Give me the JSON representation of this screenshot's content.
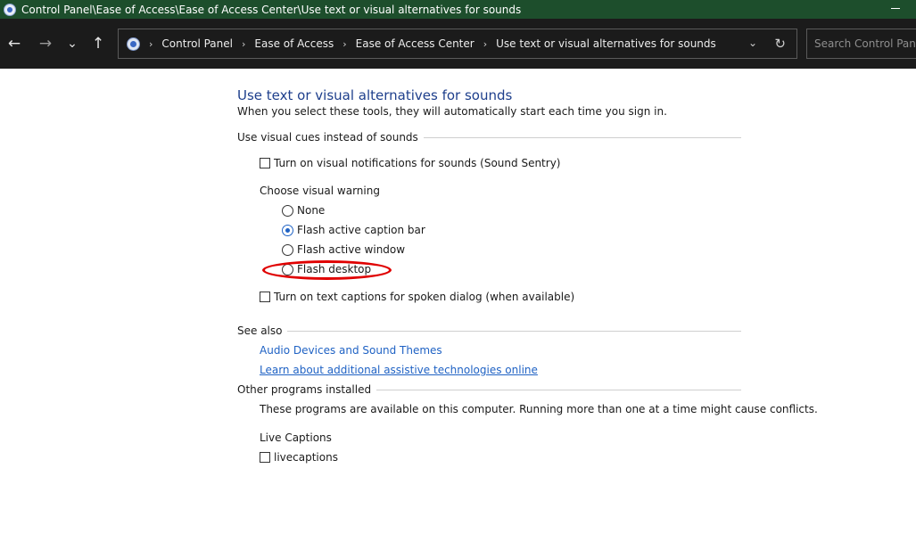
{
  "window": {
    "title": "Control Panel\\Ease of Access\\Ease of Access Center\\Use text or visual alternatives for sounds",
    "minimize_label": "–"
  },
  "nav": {
    "back_icon": "←",
    "forward_icon": "→",
    "recent_icon": "⌄",
    "up_icon": "↑",
    "breadcrumb": [
      "Control Panel",
      "Ease of Access",
      "Ease of Access Center",
      "Use text or visual alternatives for sounds"
    ],
    "separator": "›",
    "dropdown_icon": "⌄",
    "refresh_icon": "↻",
    "search_placeholder": "Search Control Panel"
  },
  "page": {
    "title": "Use text or visual alternatives for sounds",
    "subtitle": "When you select these tools, they will automatically start each time you sign in."
  },
  "visual_cues": {
    "heading": "Use visual cues instead of sounds",
    "sound_sentry_label": "Turn on visual notifications for sounds (Sound Sentry)",
    "sound_sentry_checked": false,
    "choose_warning_label": "Choose visual warning",
    "options": [
      {
        "label": "None",
        "checked": false
      },
      {
        "label": "Flash active caption bar",
        "checked": true
      },
      {
        "label": "Flash active window",
        "checked": false
      },
      {
        "label": "Flash desktop",
        "checked": false
      }
    ],
    "text_captions_label": "Turn on text captions for spoken dialog (when available)",
    "text_captions_checked": false
  },
  "see_also": {
    "heading": "See also",
    "links": [
      "Audio Devices and Sound Themes",
      "Learn about additional assistive technologies online"
    ]
  },
  "other_programs": {
    "heading": "Other programs installed",
    "description": "These programs are available on this computer. Running more than one at a time might cause conflicts.",
    "group_label": "Live Captions",
    "program_label": "livecaptions",
    "program_checked": false
  },
  "colors": {
    "titlebar_bg": "#1d4e2c",
    "navbar_bg": "#1b1b1b",
    "title_blue": "#1e3f8c",
    "link_blue": "#1f62c4",
    "annotation_red": "#e00000"
  }
}
